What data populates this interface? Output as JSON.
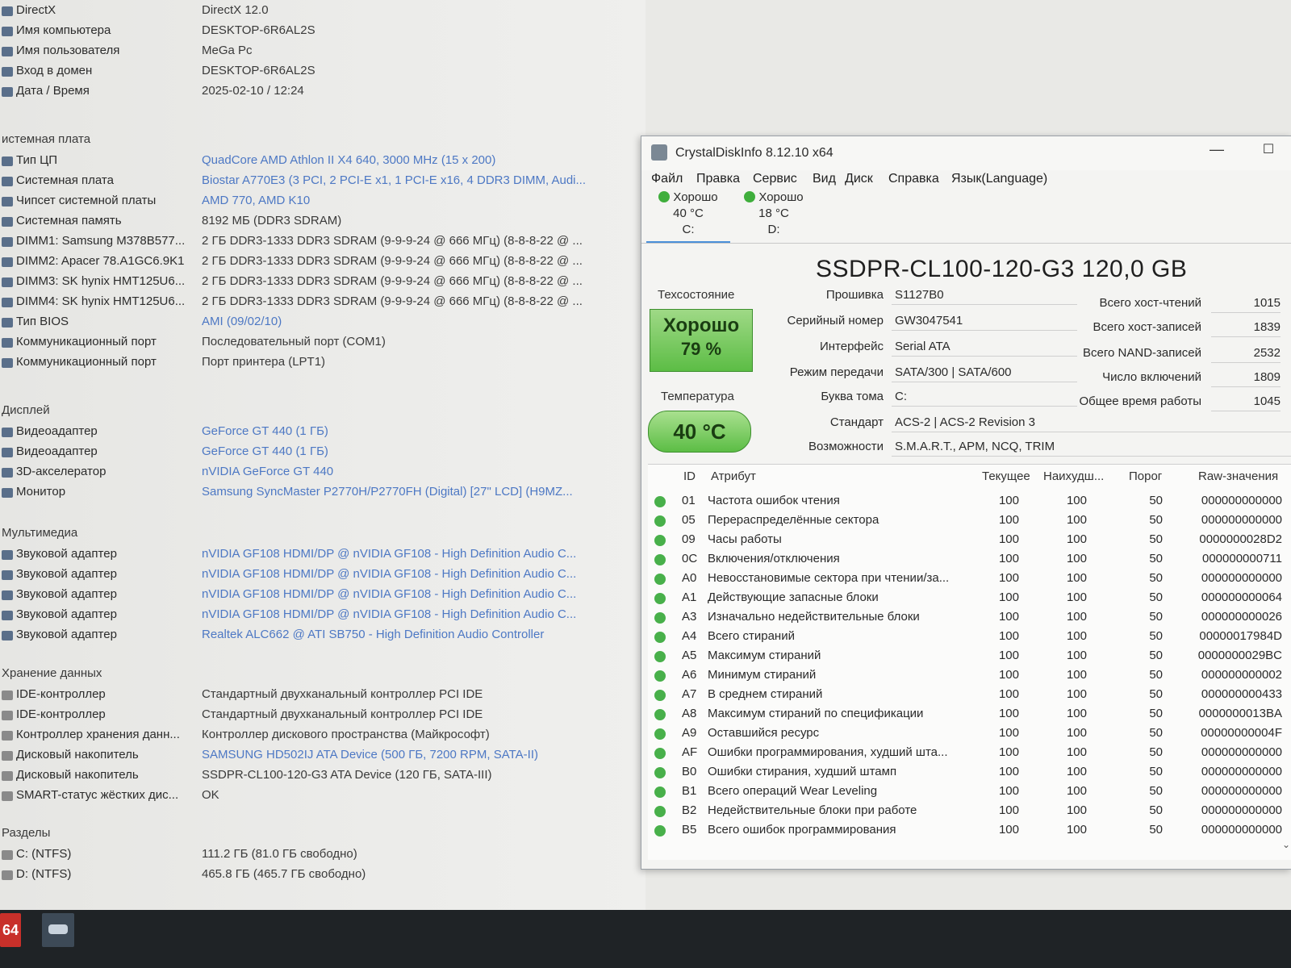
{
  "system": {
    "top_rows": [
      {
        "label": "DirectX",
        "value": "DirectX 12.0"
      },
      {
        "label": "Имя компьютера",
        "value": "DESKTOP-6R6AL2S"
      },
      {
        "label": "Имя пользователя",
        "value": "MeGa Pc"
      },
      {
        "label": "Вход в домен",
        "value": "DESKTOP-6R6AL2S"
      },
      {
        "label": "Дата / Время",
        "value": "2025-02-10 / 12:24"
      }
    ],
    "motherboard": {
      "title": "истемная плата",
      "rows": [
        {
          "label": "Тип ЦП",
          "value": "QuadCore AMD Athlon II X4 640, 3000 MHz (15 x 200)"
        },
        {
          "label": "Системная плата",
          "value": "Biostar A770E3 (3 PCI, 2 PCI-E x1, 1 PCI-E x16, 4 DDR3 DIMM, Audi..."
        },
        {
          "label": "Чипсет системной платы",
          "value": "AMD 770, AMD K10"
        },
        {
          "label": "Системная память",
          "value": "8192 МБ (DDR3 SDRAM)"
        },
        {
          "label": "DIMM1: Samsung M378B577...",
          "value": "2 ГБ DDR3-1333 DDR3 SDRAM (9-9-9-24 @ 666 МГц) (8-8-8-22 @ ..."
        },
        {
          "label": "DIMM2: Apacer 78.A1GC6.9K1",
          "value": "2 ГБ DDR3-1333 DDR3 SDRAM (9-9-9-24 @ 666 МГц) (8-8-8-22 @ ..."
        },
        {
          "label": "DIMM3: SK hynix HMT125U6...",
          "value": "2 ГБ DDR3-1333 DDR3 SDRAM (9-9-9-24 @ 666 МГц) (8-8-8-22 @ ..."
        },
        {
          "label": "DIMM4: SK hynix HMT125U6...",
          "value": "2 ГБ DDR3-1333 DDR3 SDRAM (9-9-9-24 @ 666 МГц) (8-8-8-22 @ ..."
        },
        {
          "label": "Тип BIOS",
          "value": "AMI (09/02/10)"
        },
        {
          "label": "Коммуникационный порт",
          "value": "Последовательный порт (COM1)"
        },
        {
          "label": "Коммуникационный порт",
          "value": "Порт принтера (LPT1)"
        }
      ]
    },
    "display": {
      "title": "Дисплей",
      "rows": [
        {
          "label": "Видеоадаптер",
          "value": "GeForce GT 440 (1 ГБ)"
        },
        {
          "label": "Видеоадаптер",
          "value": "GeForce GT 440 (1 ГБ)"
        },
        {
          "label": "3D-акселератор",
          "value": "nVIDIA GeForce GT 440"
        },
        {
          "label": "Монитор",
          "value": "Samsung SyncMaster P2770H/P2770FH (Digital) [27\" LCD] (H9MZ..."
        }
      ]
    },
    "multimedia": {
      "title": "Мультимедиа",
      "rows": [
        {
          "label": "Звуковой адаптер",
          "value": "nVIDIA GF108 HDMI/DP @ nVIDIA GF108 - High Definition Audio C..."
        },
        {
          "label": "Звуковой адаптер",
          "value": "nVIDIA GF108 HDMI/DP @ nVIDIA GF108 - High Definition Audio C..."
        },
        {
          "label": "Звуковой адаптер",
          "value": "nVIDIA GF108 HDMI/DP @ nVIDIA GF108 - High Definition Audio C..."
        },
        {
          "label": "Звуковой адаптер",
          "value": "nVIDIA GF108 HDMI/DP @ nVIDIA GF108 - High Definition Audio C..."
        },
        {
          "label": "Звуковой адаптер",
          "value": "Realtek ALC662 @ ATI SB750 - High Definition Audio Controller"
        }
      ]
    },
    "storage": {
      "title": "Хранение данных",
      "rows": [
        {
          "label": "IDE-контроллер",
          "value": "Стандартный двухканальный контроллер PCI IDE"
        },
        {
          "label": "IDE-контроллер",
          "value": "Стандартный двухканальный контроллер PCI IDE"
        },
        {
          "label": "Контроллер хранения данн...",
          "value": "Контроллер дискового пространства (Майкрософт)"
        },
        {
          "label": "Дисковый накопитель",
          "value": "SAMSUNG HD502IJ ATA Device (500 ГБ, 7200 RPM, SATA-II)"
        },
        {
          "label": "Дисковый накопитель",
          "value": "SSDPR-CL100-120-G3 ATA Device (120 ГБ, SATA-III)"
        },
        {
          "label": "SMART-статус жёстких дис...",
          "value": "OK"
        }
      ]
    },
    "partitions": {
      "title": "Разделы",
      "rows": [
        {
          "label": "C: (NTFS)",
          "value": "111.2 ГБ (81.0 ГБ свободно)"
        },
        {
          "label": "D: (NTFS)",
          "value": "465.8 ГБ (465.7 ГБ свободно)"
        }
      ]
    }
  },
  "taskbar": {
    "app1_label": "64"
  },
  "cdi": {
    "title": "CrystalDiskInfo 8.12.10 x64",
    "minimize": "—",
    "maximize": "☐",
    "menu": [
      "Файл",
      "Правка",
      "Сервис",
      "Вид",
      "Диск",
      "Справка",
      "Язык(Language)"
    ],
    "drives": [
      {
        "status": "Хорошо",
        "temp": "40 °C",
        "letter": "C:"
      },
      {
        "status": "Хорошо",
        "temp": "18 °C",
        "letter": "D:"
      }
    ],
    "model": "SSDPR-CL100-120-G3 120,0 GB",
    "health_label": "Техсостояние",
    "health_status": "Хорошо",
    "health_percent": "79 %",
    "temp_label": "Температура",
    "temp_value": "40 °C",
    "fields": [
      {
        "label": "Прошивка",
        "value": "S1127B0"
      },
      {
        "label": "Серийный номер",
        "value": "GW3047541"
      },
      {
        "label": "Интерфейс",
        "value": "Serial ATA"
      },
      {
        "label": "Режим передачи",
        "value": "SATA/300 | SATA/600"
      },
      {
        "label": "Буква тома",
        "value": "C:"
      },
      {
        "label": "Стандарт",
        "value": "ACS-2 | ACS-2 Revision 3"
      },
      {
        "label": "Возможности",
        "value": "S.M.A.R.T., APM, NCQ, TRIM"
      }
    ],
    "right_fields": [
      {
        "label": "Всего хост-чтений",
        "value": "1015"
      },
      {
        "label": "Всего хост-записей",
        "value": "1839"
      },
      {
        "label": "Всего NAND-записей",
        "value": "2532"
      },
      {
        "label": "Число включений",
        "value": "1809"
      },
      {
        "label": "Общее время работы",
        "value": "1045"
      }
    ],
    "smart_headers": {
      "id": "ID",
      "attr": "Атрибут",
      "cur": "Текущее",
      "worst": "Наихудш...",
      "thr": "Порог",
      "raw": "Raw-значения"
    },
    "smart_rows": [
      {
        "id": "01",
        "attr": "Частота ошибок чтения",
        "cur": "100",
        "worst": "100",
        "thr": "50",
        "raw": "000000000000"
      },
      {
        "id": "05",
        "attr": "Перераспределённые сектора",
        "cur": "100",
        "worst": "100",
        "thr": "50",
        "raw": "000000000000"
      },
      {
        "id": "09",
        "attr": "Часы работы",
        "cur": "100",
        "worst": "100",
        "thr": "50",
        "raw": "0000000028D2"
      },
      {
        "id": "0C",
        "attr": "Включения/отключения",
        "cur": "100",
        "worst": "100",
        "thr": "50",
        "raw": "000000000711"
      },
      {
        "id": "A0",
        "attr": "Невосстановимые сектора при чтении/за...",
        "cur": "100",
        "worst": "100",
        "thr": "50",
        "raw": "000000000000"
      },
      {
        "id": "A1",
        "attr": "Действующие запасные блоки",
        "cur": "100",
        "worst": "100",
        "thr": "50",
        "raw": "000000000064"
      },
      {
        "id": "A3",
        "attr": "Изначально недействительные блоки",
        "cur": "100",
        "worst": "100",
        "thr": "50",
        "raw": "000000000026"
      },
      {
        "id": "A4",
        "attr": "Всего стираний",
        "cur": "100",
        "worst": "100",
        "thr": "50",
        "raw": "00000017984D"
      },
      {
        "id": "A5",
        "attr": "Максимум стираний",
        "cur": "100",
        "worst": "100",
        "thr": "50",
        "raw": "0000000029BC"
      },
      {
        "id": "A6",
        "attr": "Минимум стираний",
        "cur": "100",
        "worst": "100",
        "thr": "50",
        "raw": "000000000002"
      },
      {
        "id": "A7",
        "attr": "В среднем стираний",
        "cur": "100",
        "worst": "100",
        "thr": "50",
        "raw": "000000000433"
      },
      {
        "id": "A8",
        "attr": "Максимум стираний по спецификации",
        "cur": "100",
        "worst": "100",
        "thr": "50",
        "raw": "0000000013BA"
      },
      {
        "id": "A9",
        "attr": "Оставшийся ресурс",
        "cur": "100",
        "worst": "100",
        "thr": "50",
        "raw": "00000000004F"
      },
      {
        "id": "AF",
        "attr": "Ошибки программирования, худший шта...",
        "cur": "100",
        "worst": "100",
        "thr": "50",
        "raw": "000000000000"
      },
      {
        "id": "B0",
        "attr": "Ошибки стирания, худший штамп",
        "cur": "100",
        "worst": "100",
        "thr": "50",
        "raw": "000000000000"
      },
      {
        "id": "B1",
        "attr": "Всего операций Wear Leveling",
        "cur": "100",
        "worst": "100",
        "thr": "50",
        "raw": "000000000000"
      },
      {
        "id": "B2",
        "attr": "Недействительные блоки при работе",
        "cur": "100",
        "worst": "100",
        "thr": "50",
        "raw": "000000000000"
      },
      {
        "id": "B5",
        "attr": "Всего ошибок программирования",
        "cur": "100",
        "worst": "100",
        "thr": "50",
        "raw": "000000000000"
      }
    ]
  },
  "colors": {
    "good_green": "#5cbd45",
    "link_blue": "#4d78c4",
    "taskbar": "#1f2326"
  }
}
